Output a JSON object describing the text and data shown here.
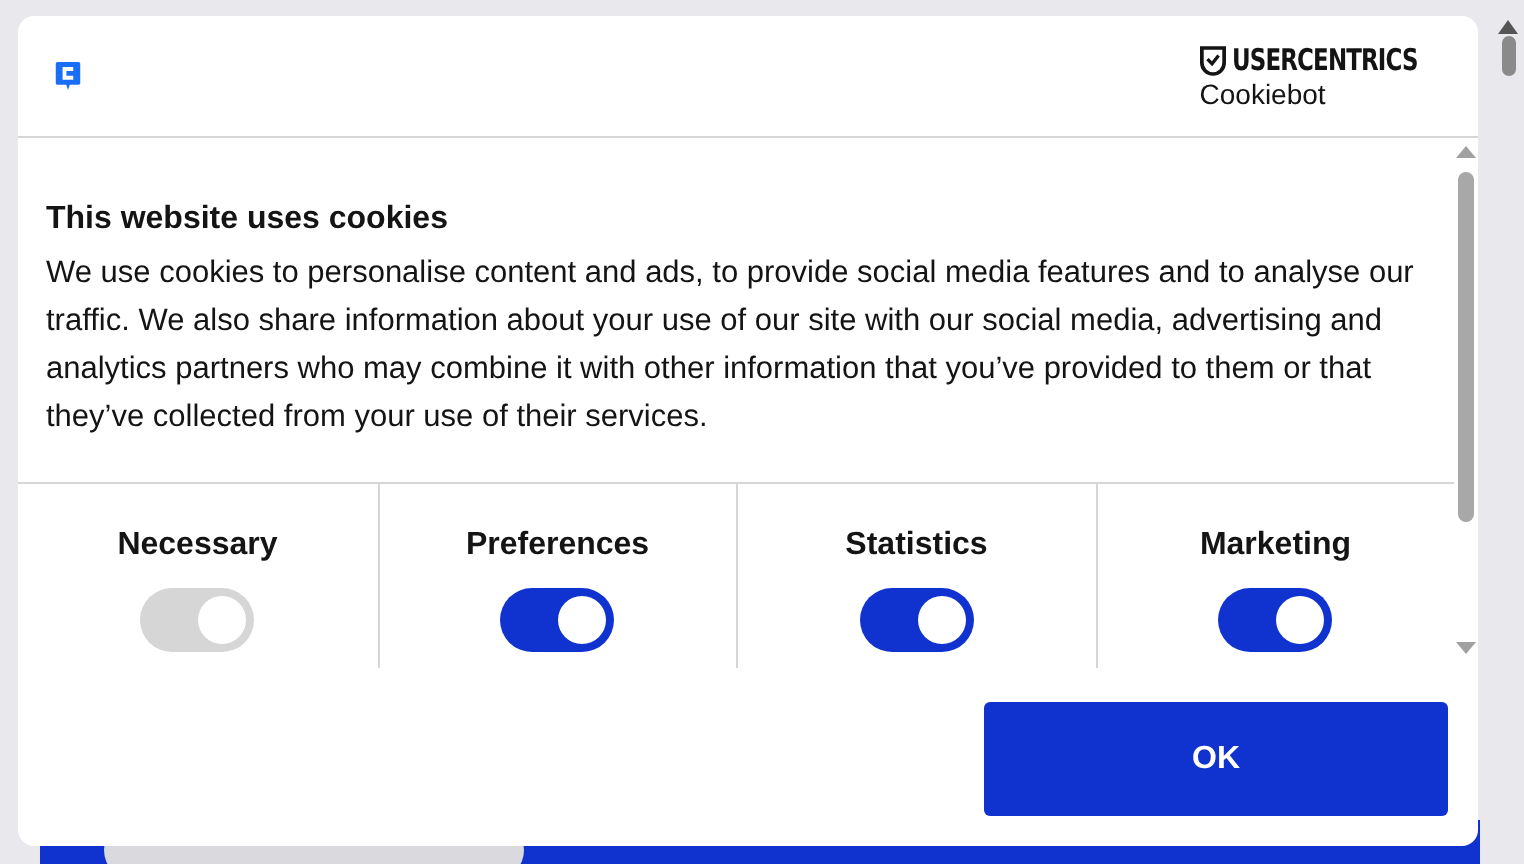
{
  "header": {
    "brand_name": "USERCENTRICS",
    "brand_product": "Cookiebot"
  },
  "notice": {
    "title": "This website uses cookies",
    "body": "We use cookies to personalise content and ads, to provide social media features and to analyse our traffic. We also share information about your use of our site with our social media, advertising and analytics partners who may combine it with other information that you’ve provided to them or that they’ve collected from your use of their services."
  },
  "categories": [
    {
      "label": "Necessary",
      "on": true,
      "disabled": true
    },
    {
      "label": "Preferences",
      "on": true,
      "disabled": false
    },
    {
      "label": "Statistics",
      "on": true,
      "disabled": false
    },
    {
      "label": "Marketing",
      "on": true,
      "disabled": false
    }
  ],
  "buttons": [
    {
      "label": "OK"
    }
  ]
}
